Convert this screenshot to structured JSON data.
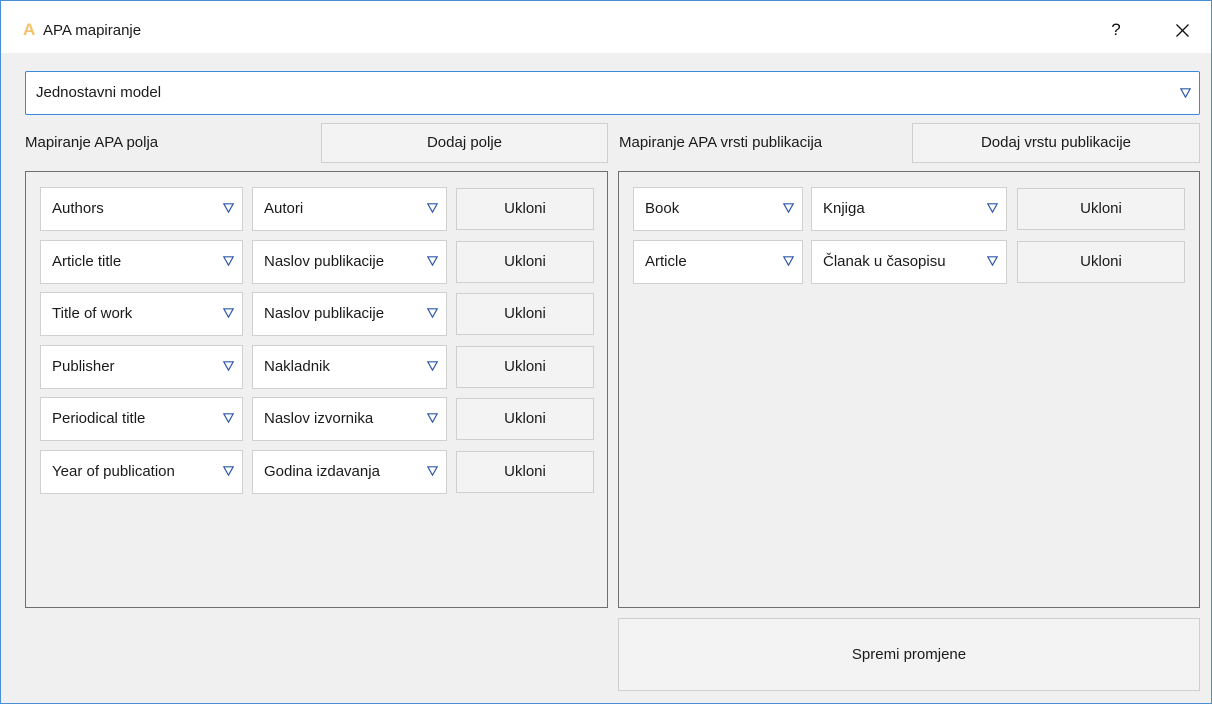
{
  "window": {
    "title": "APA mapiranje",
    "help_label": "?"
  },
  "model_select": {
    "value": "Jednostavni model"
  },
  "fields_section": {
    "label": "Mapiranje APA polja",
    "add_button": "Dodaj polje",
    "rows": [
      {
        "source": "Authors",
        "target": "Autori",
        "remove": "Ukloni"
      },
      {
        "source": "Article title",
        "target": "Naslov publikacije",
        "remove": "Ukloni"
      },
      {
        "source": "Title of work",
        "target": "Naslov publikacije",
        "remove": "Ukloni"
      },
      {
        "source": "Publisher",
        "target": "Nakladnik",
        "remove": "Ukloni"
      },
      {
        "source": "Periodical title",
        "target": "Naslov izvornika",
        "remove": "Ukloni"
      },
      {
        "source": "Year of publication",
        "target": "Godina izdavanja",
        "remove": "Ukloni"
      }
    ]
  },
  "types_section": {
    "label": "Mapiranje APA vrsti publikacija",
    "add_button": "Dodaj vrstu publikacije",
    "rows": [
      {
        "source": "Book",
        "target": "Knjiga",
        "remove": "Ukloni"
      },
      {
        "source": "Article",
        "target": "Članak u časopisu",
        "remove": "Ukloni"
      }
    ]
  },
  "save_button": "Spremi promjene",
  "colors": {
    "accent": "#3b8ad9",
    "arrow": "#2f5aa8",
    "icon": "#f3c26b"
  }
}
